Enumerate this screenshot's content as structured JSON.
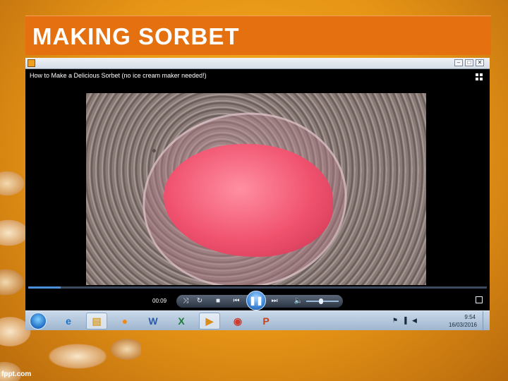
{
  "slide": {
    "title": "MAKING SORBET",
    "footer_logo": "fppt.com"
  },
  "player": {
    "video_title": "How to Make a Delicious Sorbet (no ice cream maker needed!)",
    "elapsed_time": "00:09",
    "seek_progress": 0.07,
    "volume_level": 0.45,
    "window_buttons": [
      "–",
      "□",
      "✕"
    ],
    "controls": {
      "shuffle": "⤨",
      "repeat": "↻",
      "stop": "■",
      "previous": "⏮",
      "play_pause": "❚❚",
      "next": "⏭",
      "volume": "🔈"
    }
  },
  "taskbar": {
    "apps": [
      {
        "name": "internet-explorer-icon",
        "glyph": "e",
        "color": "#1d73c9"
      },
      {
        "name": "file-explorer-icon",
        "glyph": "▤",
        "color": "#d9a032"
      },
      {
        "name": "media-icon",
        "glyph": "●",
        "color": "#f08a12"
      },
      {
        "name": "word-icon",
        "glyph": "W",
        "color": "#2a5aa8"
      },
      {
        "name": "excel-icon",
        "glyph": "X",
        "color": "#1f7a3a"
      },
      {
        "name": "media-player-icon",
        "glyph": "▶",
        "color": "#d98d1a"
      },
      {
        "name": "chrome-icon",
        "glyph": "◉",
        "color": "#cc3b2e"
      },
      {
        "name": "powerpoint-icon",
        "glyph": "P",
        "color": "#c6421c"
      }
    ],
    "tray": {
      "flag": "⚑",
      "network": "▐",
      "volume": "◀",
      "time": "9:54",
      "date": "16/03/2016"
    }
  }
}
